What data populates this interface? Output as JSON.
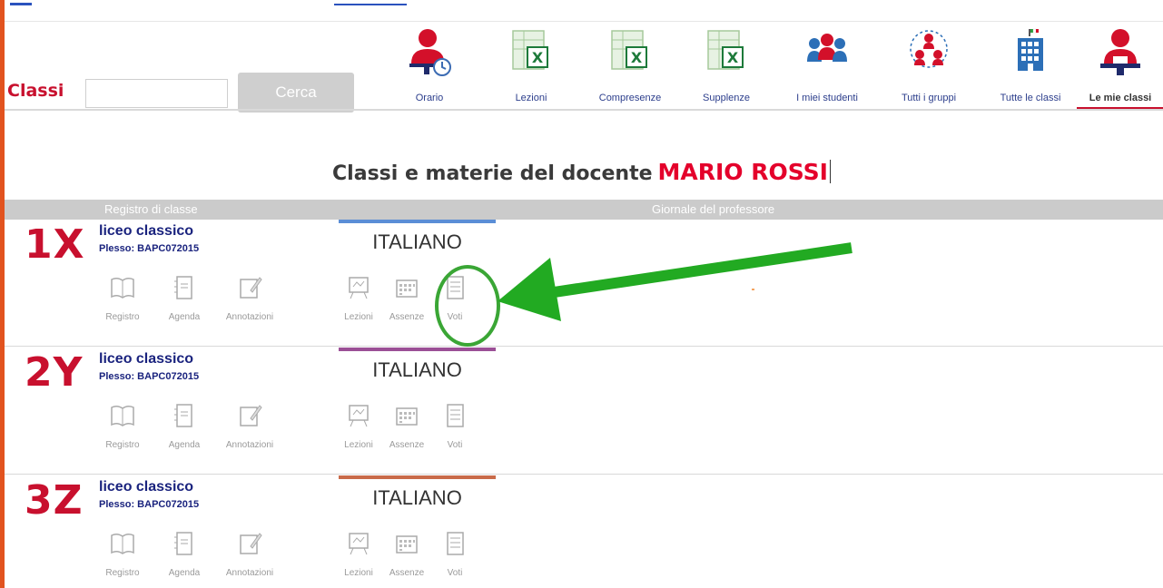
{
  "header": {
    "search_label": "Classi",
    "search_input_value": "",
    "search_button": "Cerca",
    "nav": [
      {
        "label": "Orario",
        "icon": "teacher-clock-icon"
      },
      {
        "label": "Lezioni",
        "icon": "excel-icon"
      },
      {
        "label": "Compresenze",
        "icon": "excel-icon"
      },
      {
        "label": "Supplenze",
        "icon": "excel-icon"
      },
      {
        "label": "I miei studenti",
        "icon": "students-icon"
      },
      {
        "label": "Tutti i gruppi",
        "icon": "groups-icon"
      },
      {
        "label": "Tutte le classi",
        "icon": "school-building-icon"
      },
      {
        "label": "Le mie classi",
        "icon": "teacher-desk-icon",
        "active": true
      }
    ]
  },
  "title": {
    "prefix": "Classi e materie del docente",
    "teacher_name": "MARIO ROSSI"
  },
  "table_headers": {
    "registro": "Registro di classe",
    "giornale": "Giornale del professore"
  },
  "classes": [
    {
      "code": "1X",
      "type": "liceo classico",
      "plesso": "Plesso: BAPC072015",
      "subject": "ITALIANO",
      "subject_color": "#5b8ed6",
      "registro_tools": [
        "Registro",
        "Agenda",
        "Annotazioni"
      ],
      "giornale_tools": [
        "Lezioni",
        "Assenze",
        "Voti"
      ]
    },
    {
      "code": "2Y",
      "type": "liceo classico",
      "plesso": "Plesso: BAPC072015",
      "subject": "ITALIANO",
      "subject_color": "#9b4f96",
      "registro_tools": [
        "Registro",
        "Agenda",
        "Annotazioni"
      ],
      "giornale_tools": [
        "Lezioni",
        "Assenze",
        "Voti"
      ]
    },
    {
      "code": "3Z",
      "type": "liceo classico",
      "plesso": "Plesso: BAPC072015",
      "subject": "ITALIANO",
      "subject_color": "#c96b4a",
      "registro_tools": [
        "Registro",
        "Agenda",
        "Annotazioni"
      ],
      "giornale_tools": [
        "Lezioni",
        "Assenze",
        "Voti"
      ]
    }
  ],
  "colors": {
    "accent_red": "#c8102e",
    "nav_blue": "#2c3e8c",
    "highlight_green": "#3aa635",
    "left_bar": "#e2531f"
  }
}
